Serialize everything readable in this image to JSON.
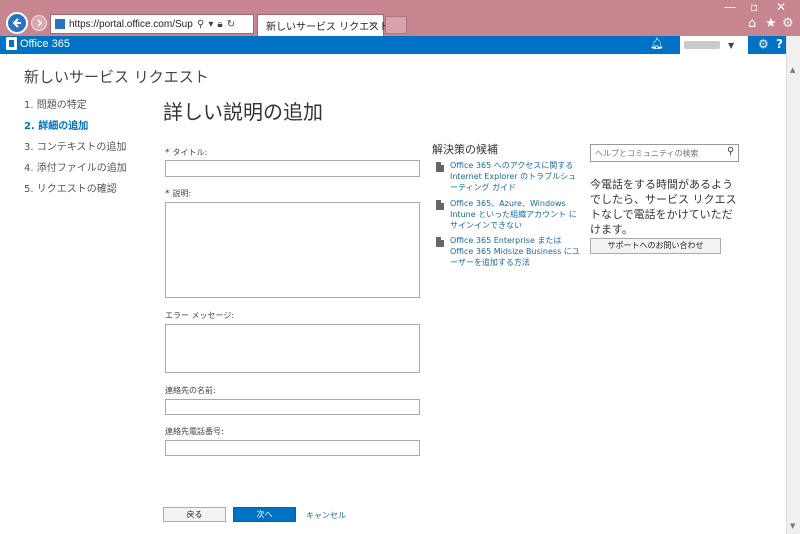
{
  "browser": {
    "url": "https://portal.office.com/Support/NewS",
    "tab_title": "新しいサービス リクエスト",
    "tab_close": "×"
  },
  "suitebar": {
    "app_name": "Office 365"
  },
  "page": {
    "heading": "新しいサービス リクエスト",
    "steps": [
      "1. 問題の特定",
      "2. 詳細の追加",
      "3. コンテキストの追加",
      "4. 添付ファイルの追加",
      "5. リクエストの確認"
    ],
    "active_step": 1,
    "section_title": "詳しい説明の追加"
  },
  "form": {
    "title_label": "タイトル:",
    "description_label": "説明:",
    "error_label": "エラー メッセージ:",
    "contact_name_label": "連絡先の名前:",
    "contact_phone_label": "連絡先電話番号:",
    "required_mark": "*"
  },
  "suggestions": {
    "title": "解決策の候補",
    "items": [
      "Office 365 へのアクセスに関する Internet Explorer のトラブルシューティング ガイド",
      "Office 365、Azure、Windows Intune といった組織アカウント にサインインできない",
      "Office 365 Enterprise または Office 365 Midsize Business にユーザーを追加する方法"
    ]
  },
  "sidebar_right": {
    "search_placeholder": "ヘルプとコミュニティの検索",
    "phone_text": "今電話をする時間があるようでしたら、サービス リクエストなしで電話をかけていただけます。",
    "contact_button": "サポートへのお問い合わせ"
  },
  "buttons": {
    "back": "戻る",
    "next": "次へ",
    "cancel": "キャンセル"
  },
  "colors": {
    "accent": "#0072c6",
    "chrome": "#c6858f",
    "link": "#1a6aa6"
  }
}
